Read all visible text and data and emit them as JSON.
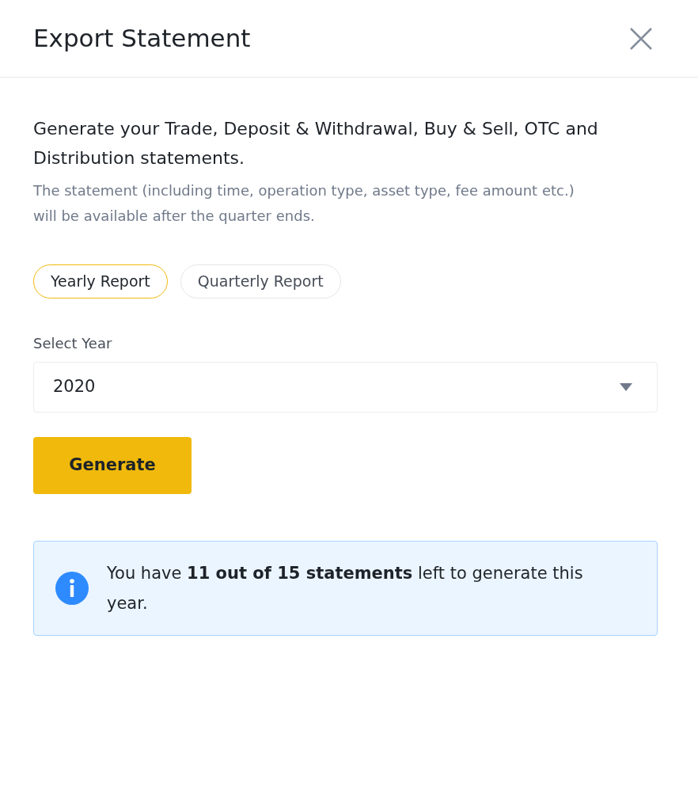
{
  "dialog": {
    "title": "Export Statement"
  },
  "description": "Generate your Trade, Deposit & Withdrawal, Buy & Sell, OTC and Distribution statements.",
  "note": "The statement (including time, operation type, asset type, fee amount etc.) will be available after the quarter ends.",
  "report_types": [
    {
      "label": "Yearly Report",
      "selected": true
    },
    {
      "label": "Quarterly Report",
      "selected": false
    }
  ],
  "year_select": {
    "label": "Select Year",
    "value": "2020"
  },
  "generate_button": {
    "label": "Generate"
  },
  "info": {
    "text": "You have **11 out of 15 statements** left to generate this year."
  }
}
